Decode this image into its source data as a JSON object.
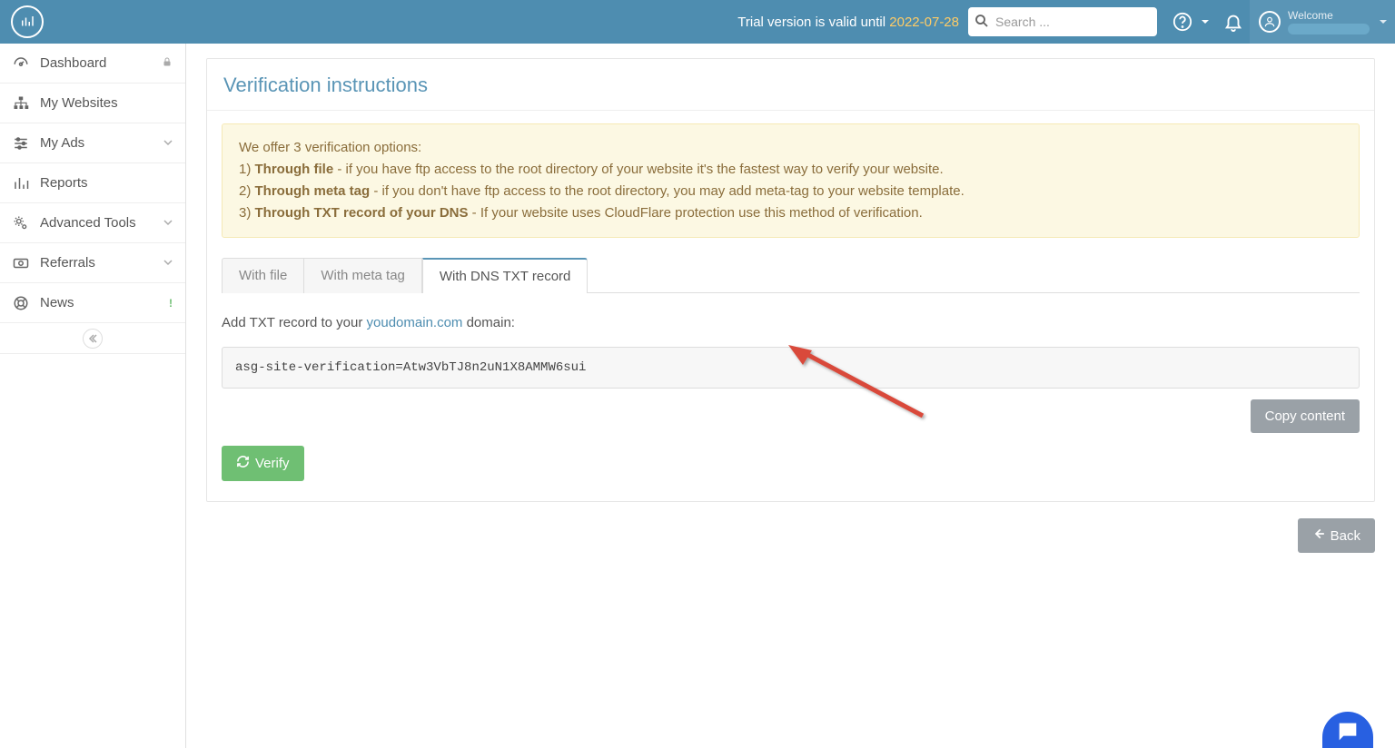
{
  "header": {
    "trial_prefix": "Trial version is valid until ",
    "trial_date": "2022-07-28",
    "search_placeholder": "Search ...",
    "welcome_label": "Welcome"
  },
  "sidebar": {
    "items": [
      {
        "label": "Dashboard"
      },
      {
        "label": "My Websites"
      },
      {
        "label": "My Ads"
      },
      {
        "label": "Reports"
      },
      {
        "label": "Advanced Tools"
      },
      {
        "label": "Referrals"
      },
      {
        "label": "News"
      }
    ]
  },
  "page": {
    "title": "Verification instructions",
    "alert": {
      "intro": "We offer 3 verification options:",
      "opt1_num": "1) ",
      "opt1_bold": "Through file",
      "opt1_rest": " - if you have ftp access to the root directory of your website it's the fastest way to verify your website.",
      "opt2_num": "2) ",
      "opt2_bold": "Through meta tag",
      "opt2_rest": " - if you don't have ftp access to the root directory, you may add meta-tag to your website template.",
      "opt3_num": "3) ",
      "opt3_bold": "Through TXT record of your DNS",
      "opt3_rest": " - If your website uses CloudFlare protection use this method of verification."
    },
    "tabs": [
      {
        "label": "With file"
      },
      {
        "label": "With meta tag"
      },
      {
        "label": "With DNS TXT record"
      }
    ],
    "active_tab_index": 2,
    "instruction_prefix": "Add TXT record to your ",
    "instruction_domain": "youdomain.com",
    "instruction_suffix": " domain:",
    "txt_record": "asg-site-verification=Atw3VbTJ8n2uN1X8AMMW6sui",
    "copy_button": "Copy content",
    "verify_button": "Verify",
    "back_button": "Back"
  }
}
